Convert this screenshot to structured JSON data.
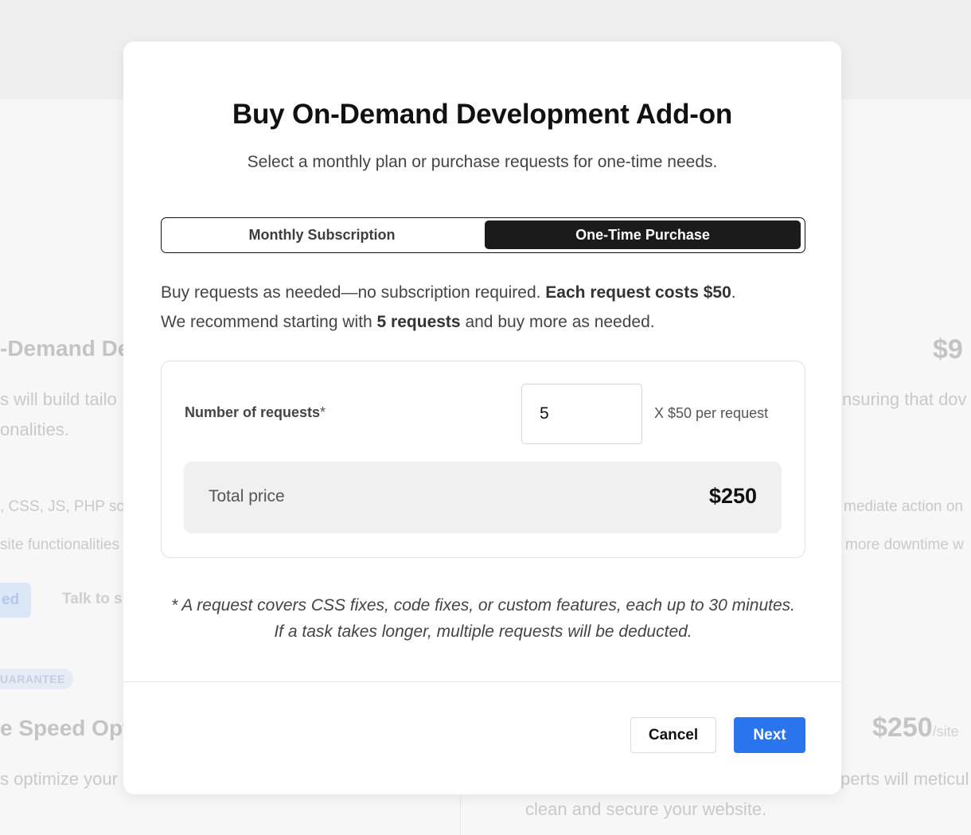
{
  "background": {
    "title_fragment": "-Demand Dev",
    "price_fragment": "$9",
    "line1_fragment": "s will build tailo",
    "line2_fragment": "onalities.",
    "line1_right_fragment": "nsuring that dov",
    "tags_fragment": ", CSS, JS, PHP scri",
    "tags2_fragment": "site functionalities",
    "tags_right_fragment": "mediate action on",
    "tags2_right_fragment": "more downtime w",
    "button_fragment": "ed",
    "link_fragment": "Talk to s",
    "badge_fragment": "UARANTEE",
    "second_title_fragment": "e Speed Opti",
    "second_price": "$250",
    "second_price_suffix": "/site",
    "second_line_fragment": "s optimize your",
    "second_line_right_fragment": "perts will meticul",
    "second_line2_fragment": "clean and secure your website."
  },
  "modal": {
    "title": "Buy On-Demand Development Add-on",
    "subtitle": "Select a monthly plan or purchase requests for one-time needs.",
    "tabs": [
      {
        "label": "Monthly Subscription",
        "active": false
      },
      {
        "label": "One-Time Purchase",
        "active": true
      }
    ],
    "description": {
      "part1": "Buy requests as needed—no subscription required. ",
      "bold1": "Each request costs $50",
      "part2": ".",
      "part3": "We recommend starting with ",
      "bold2": "5 requests",
      "part4": " and buy more as needed."
    },
    "requests": {
      "label": "Number of requests",
      "required_marker": "*",
      "value": "5",
      "unit_text": "X $50 per request"
    },
    "total": {
      "label": "Total price",
      "value": "$250"
    },
    "footnote": "* A request covers CSS fixes, code fixes, or custom features, each up to 30 minutes. If a task takes longer, multiple requests will be deducted.",
    "buttons": {
      "cancel": "Cancel",
      "next": "Next"
    },
    "colors": {
      "primary": "#2a74ee",
      "toggle_active": "#1b1b1b"
    }
  }
}
